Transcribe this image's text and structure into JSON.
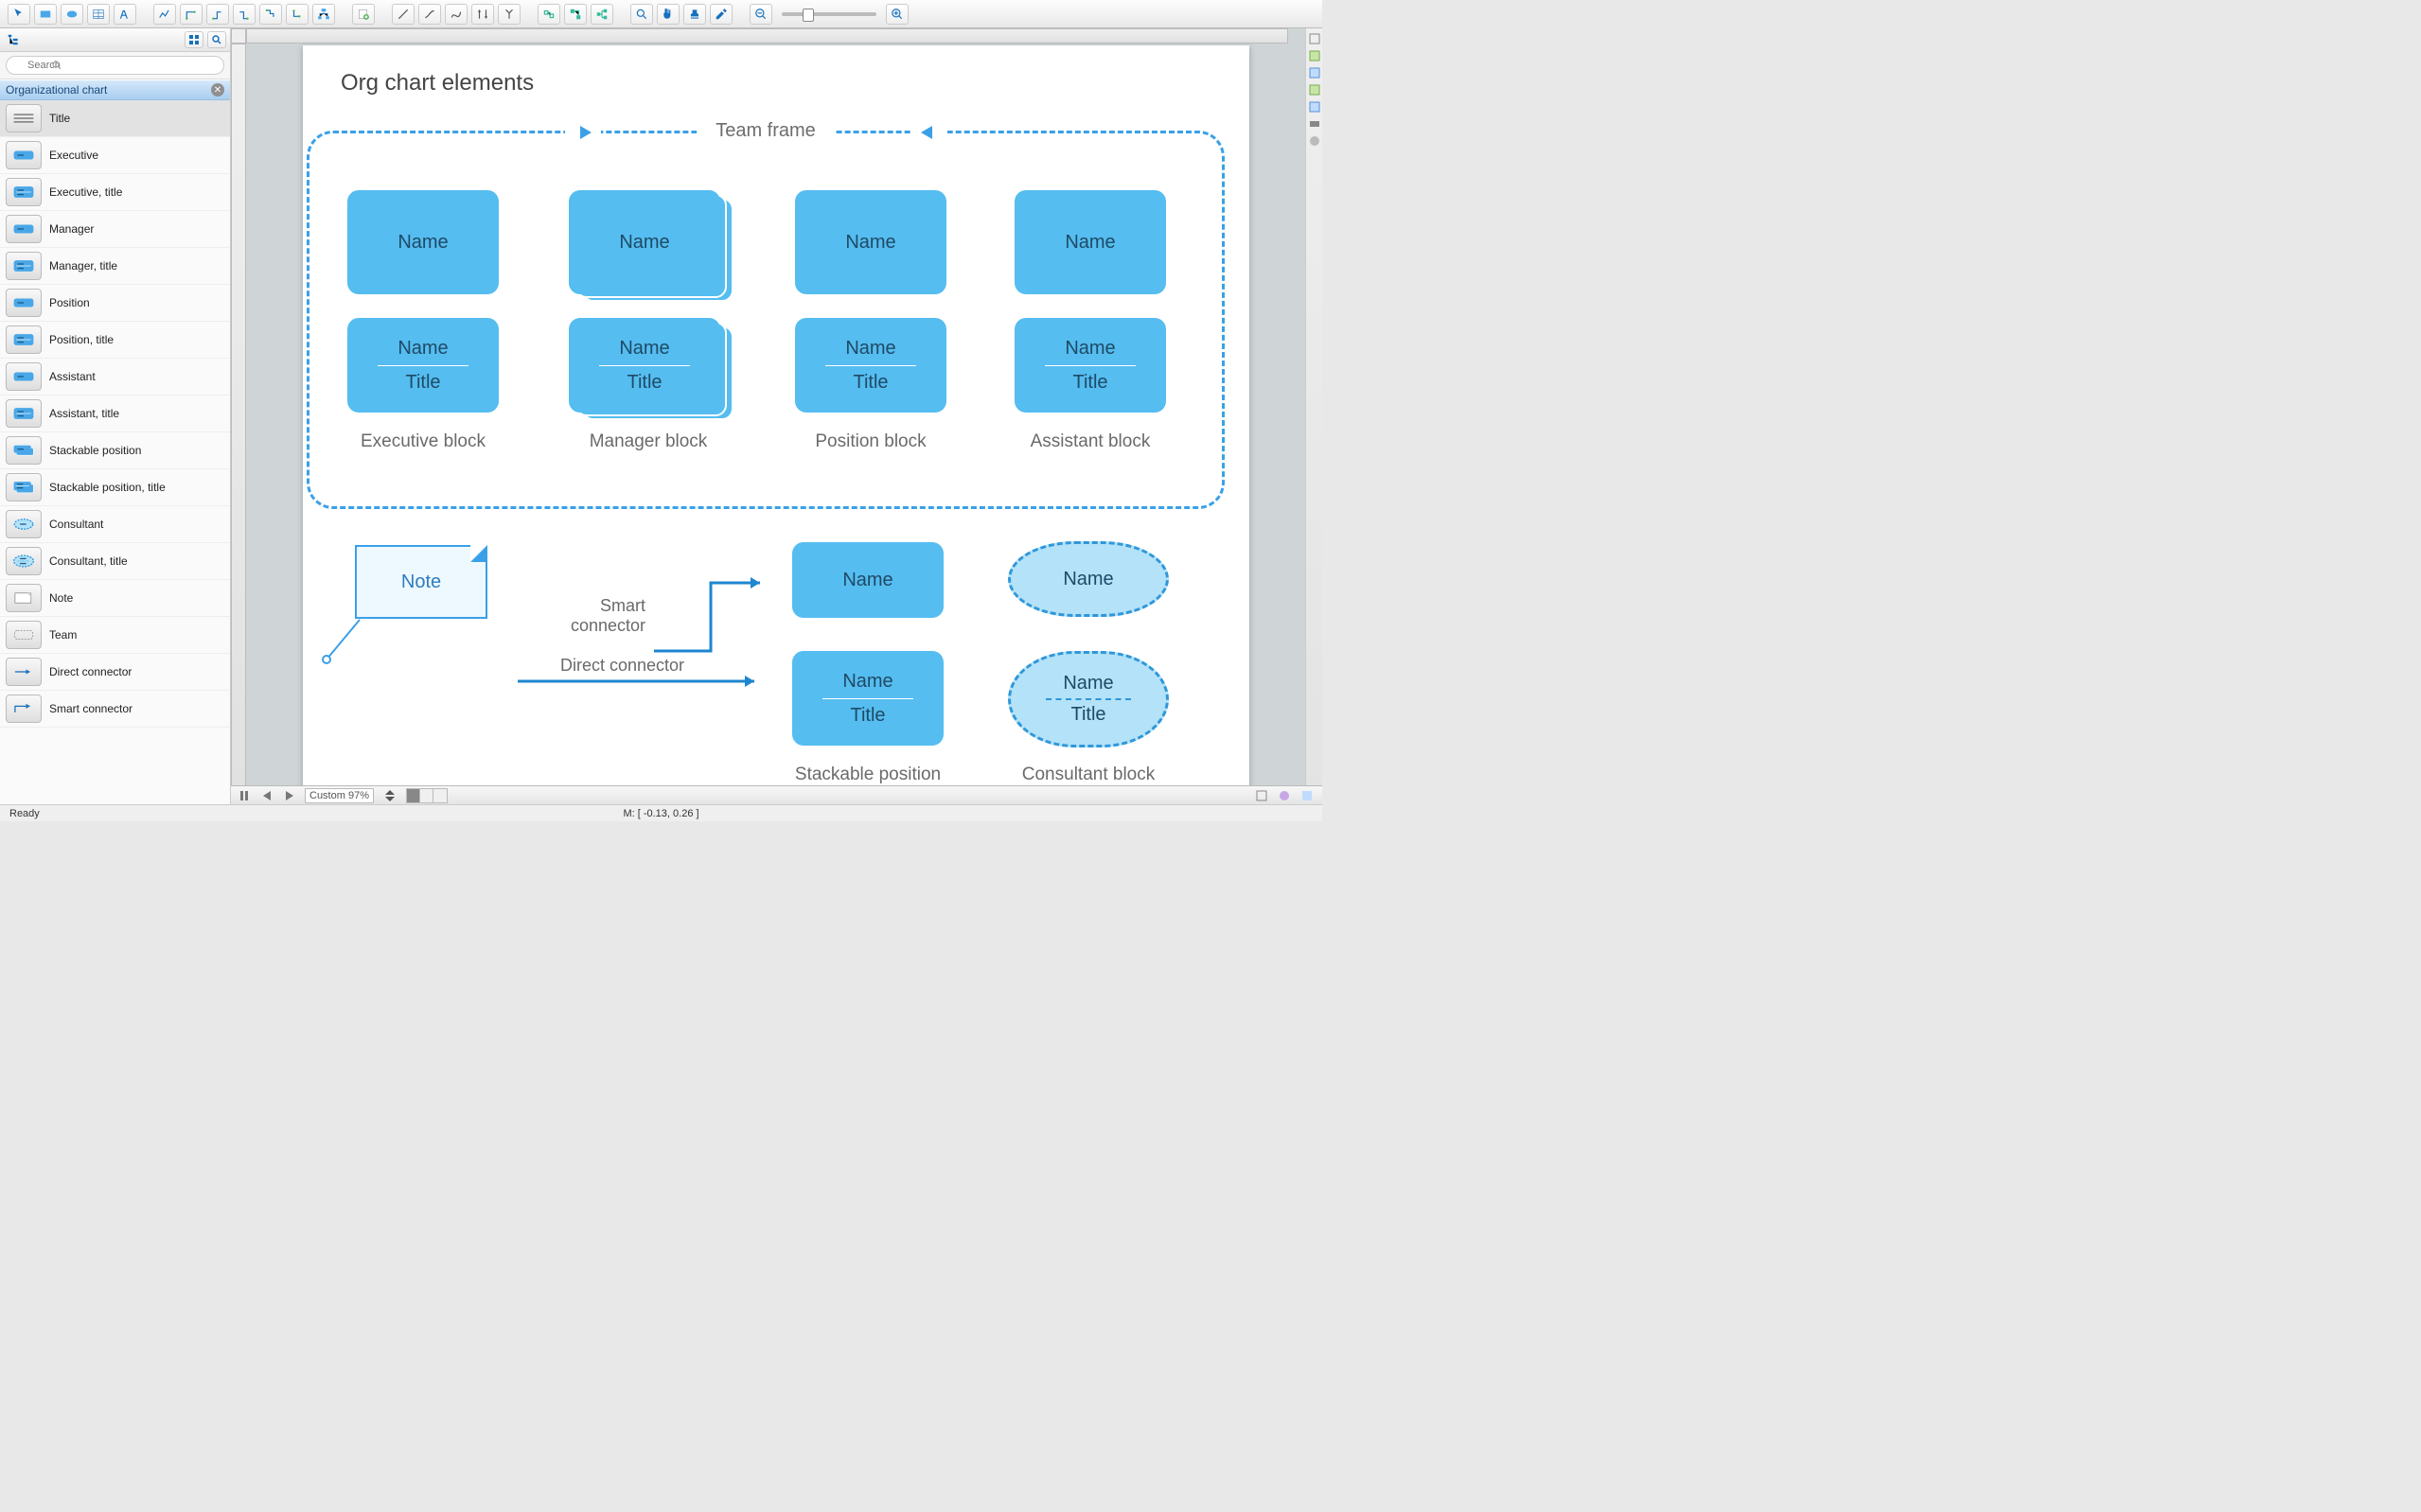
{
  "search": {
    "placeholder": "Search"
  },
  "library": {
    "title": "Organizational chart",
    "items": [
      "Title",
      "Executive",
      "Executive, title",
      "Manager",
      "Manager, title",
      "Position",
      "Position, title",
      "Assistant",
      "Assistant, title",
      "Stackable position",
      "Stackable position, title",
      "Consultant",
      "Consultant, title",
      "Note",
      "Team",
      "Direct connector",
      "Smart connector"
    ]
  },
  "canvas": {
    "heading": "Org chart elements",
    "team_frame_label": "Team frame",
    "name": "Name",
    "title": "Title",
    "captions": {
      "executive": "Executive block",
      "manager": "Manager block",
      "position": "Position block",
      "assistant": "Assistant block",
      "stackable": "Stackable position block",
      "consultant": "Consultant block"
    },
    "note": "Note",
    "smart": "Smart connector",
    "direct": "Direct connector"
  },
  "bottom": {
    "zoom": "Custom 97%"
  },
  "status": {
    "ready": "Ready",
    "mouse": "M: [ -0.13, 0.26 ]"
  }
}
